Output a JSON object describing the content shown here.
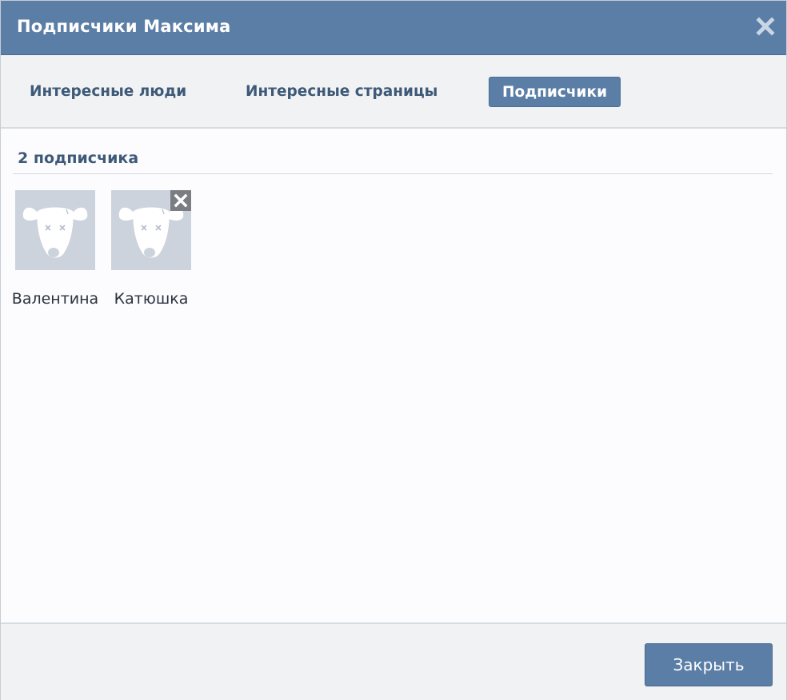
{
  "dialog": {
    "title": "Подписчики Максима",
    "close_icon": "close-icon"
  },
  "tabs": [
    {
      "label": "Интересные люди",
      "active": false
    },
    {
      "label": "Интересные страницы",
      "active": false
    },
    {
      "label": "Подписчики",
      "active": true
    }
  ],
  "subscribers": {
    "count_label": "2 подписчика",
    "people": [
      {
        "name": "Валентина",
        "avatar_icon": "default-avatar-icon",
        "removable": false
      },
      {
        "name": "Катюшка",
        "avatar_icon": "default-avatar-icon",
        "removable": true
      }
    ]
  },
  "footer": {
    "close_label": "Закрыть"
  },
  "colors": {
    "header": "#5b7ea6",
    "accent_text": "#3e5a78",
    "avatar_bg": "#cdd3dc"
  }
}
